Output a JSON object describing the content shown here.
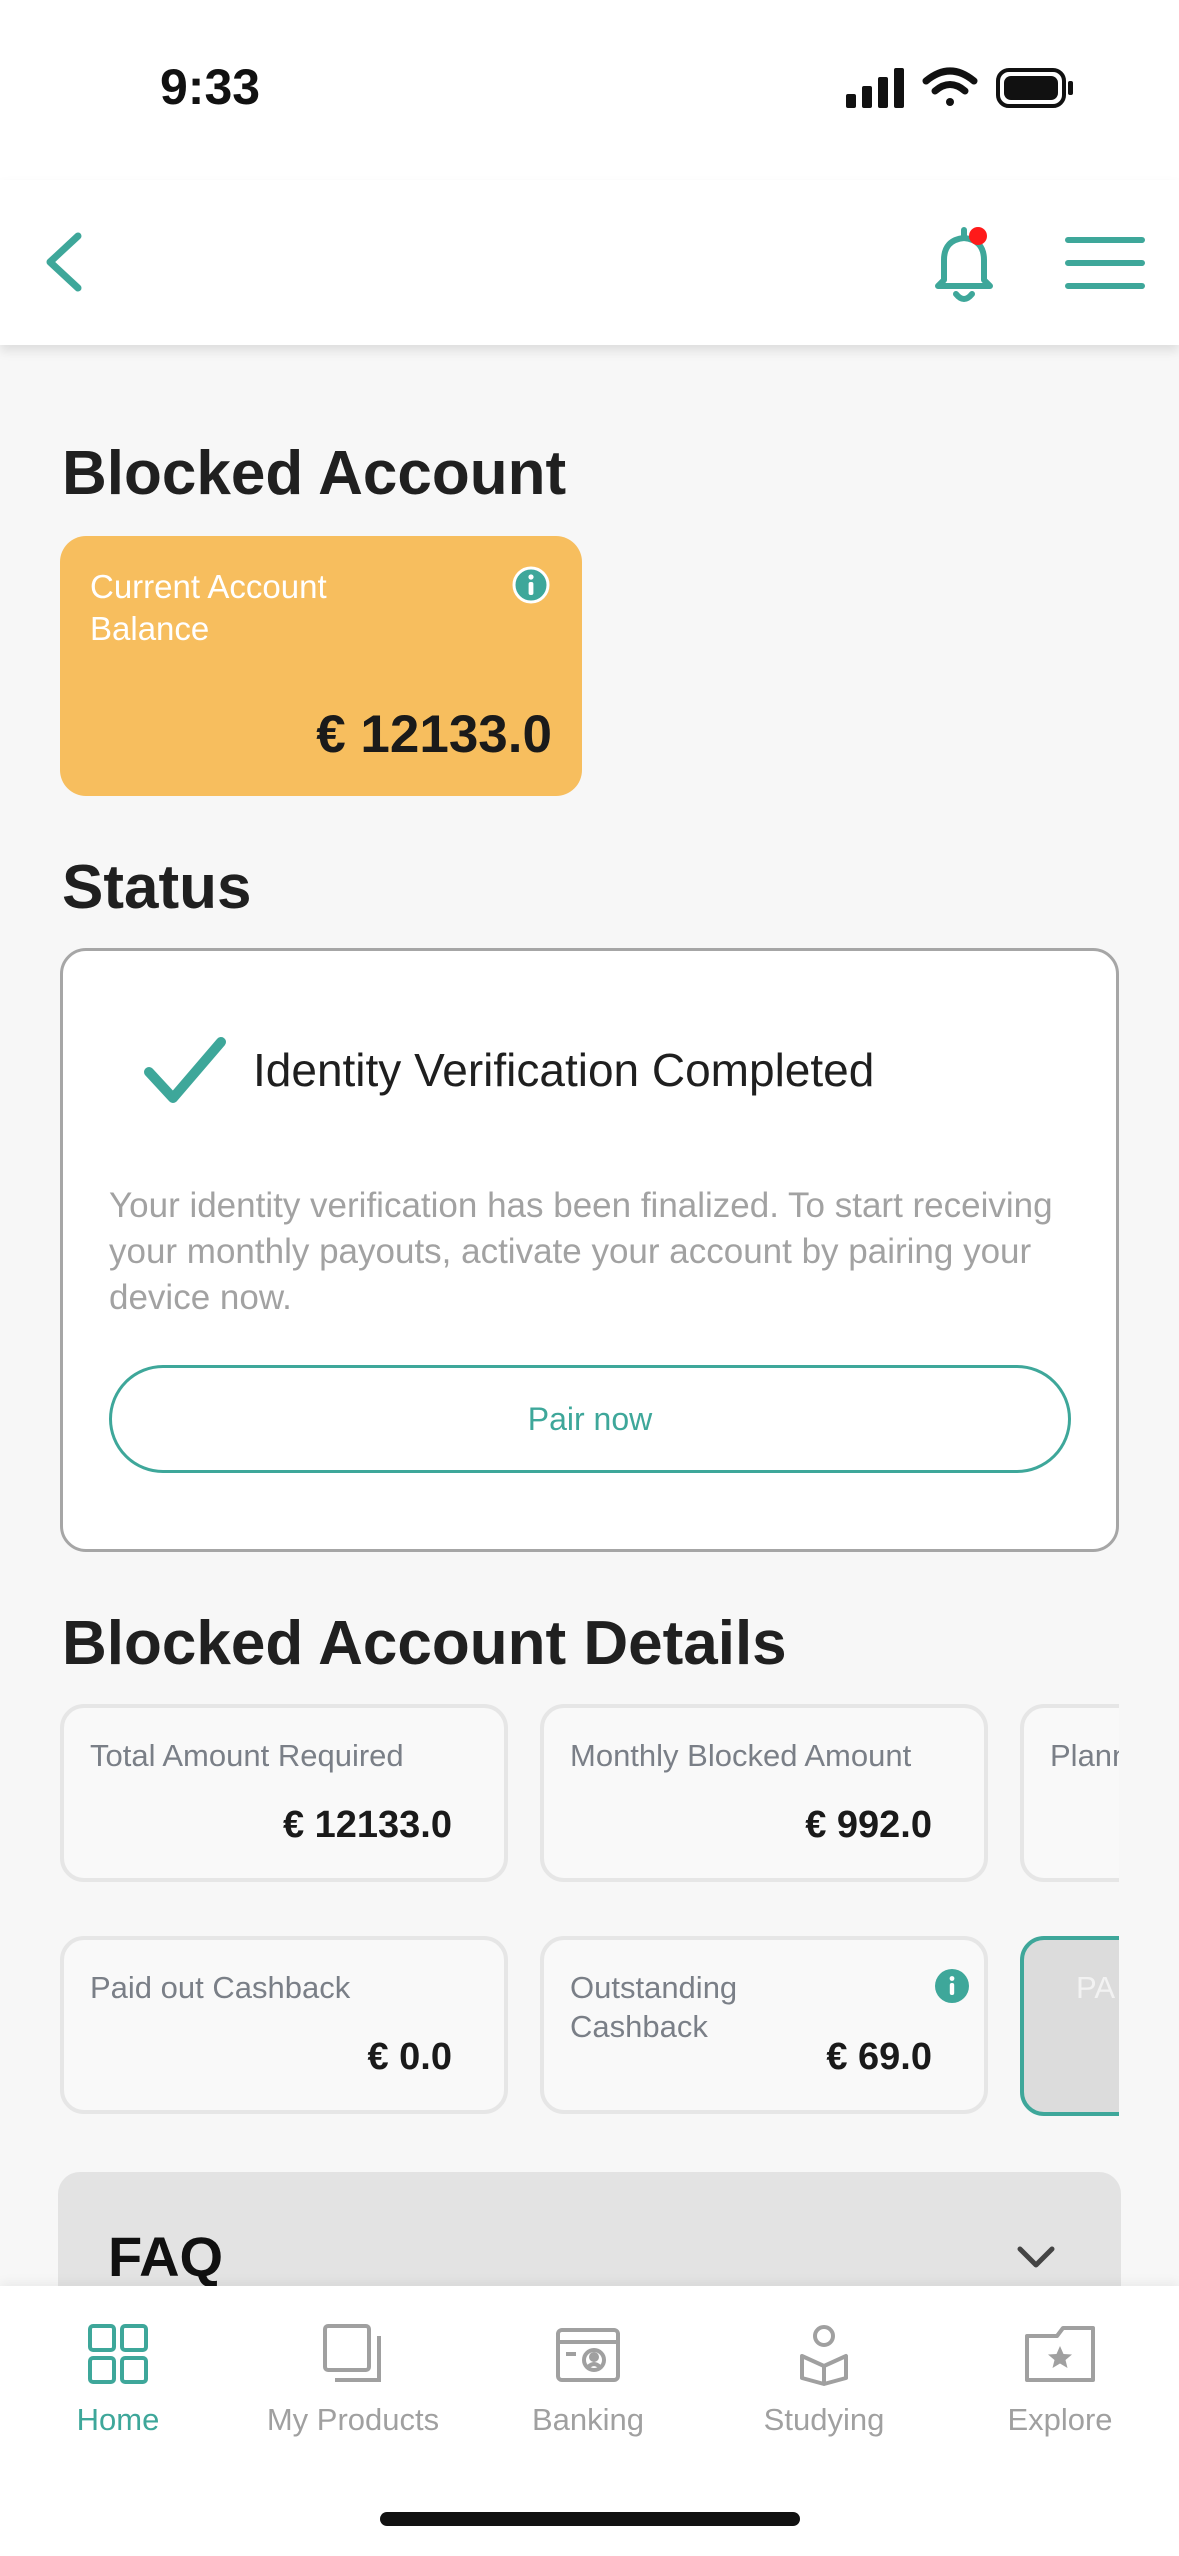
{
  "status_bar": {
    "time": "9:33"
  },
  "header": {
    "notification_dot_color": "#ff1a1a",
    "accent": "#3ea79a"
  },
  "page": {
    "title": "Blocked Account"
  },
  "balance": {
    "label": "Current Account Balance",
    "value": "€ 12133.0",
    "card_color": "#f7be5e"
  },
  "status": {
    "heading": "Status",
    "title": "Identity Verification Completed",
    "description": "Your identity verification has been finalized. To start receiving your monthly payouts, activate your account by pairing your device now.",
    "button": "Pair now"
  },
  "details": {
    "heading": "Blocked Account Details",
    "cards": [
      {
        "label": "Total Amount Required",
        "value": "€ 12133.0"
      },
      {
        "label": "Monthly Blocked Amount",
        "value": "€ 992.0"
      },
      {
        "label": "Plann",
        "value": ""
      },
      {
        "label": "Paid out Cashback",
        "value": "€ 0.0"
      },
      {
        "label": "Outstanding Cashback",
        "value": "€ 69.0"
      },
      {
        "label": "PA"
      }
    ]
  },
  "faq": {
    "title": "FAQ"
  },
  "nav": {
    "items": [
      {
        "label": "Home",
        "icon": "home-grid-icon",
        "active": true
      },
      {
        "label": "My Products",
        "icon": "products-icon",
        "active": false
      },
      {
        "label": "Banking",
        "icon": "bank-card-icon",
        "active": false
      },
      {
        "label": "Studying",
        "icon": "studying-icon",
        "active": false
      },
      {
        "label": "Explore",
        "icon": "explore-folder-icon",
        "active": false
      }
    ]
  }
}
